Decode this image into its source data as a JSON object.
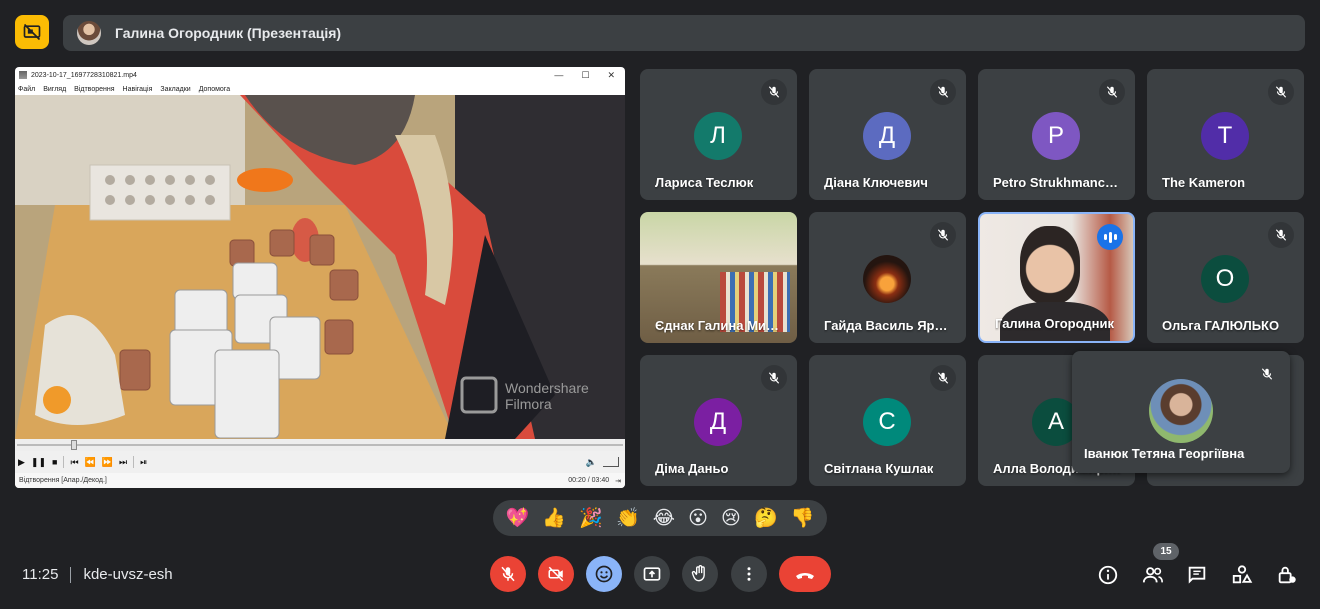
{
  "presenter": {
    "name": "Галина Огородник (Презентація)"
  },
  "shared_window": {
    "title": "2023-10-17_1697728310821.mp4",
    "menu": [
      "Файл",
      "Вигляд",
      "Відтворення",
      "Навігація",
      "Закладки",
      "Допомога"
    ],
    "watermark_line1": "Wondershare",
    "watermark_line2": "Filmora",
    "status": "Відтворення [Апар./Декод.]",
    "time": "00:20 / 03:40"
  },
  "participants": [
    {
      "name": "Лариса Теслюк",
      "initial": "Л",
      "color": "#137a6b"
    },
    {
      "name": "Діана Ключевич",
      "initial": "Д",
      "color": "#5c6bc0"
    },
    {
      "name": "Petro Strukhmanchuk",
      "initial": "P",
      "color": "#7e57c2"
    },
    {
      "name": "The Kameron",
      "initial": "T",
      "color": "#512da8"
    },
    {
      "name": "Єднак Галина Михайлівна",
      "initial": "",
      "color": ""
    },
    {
      "name": "Гайда Василь Ярославович",
      "initial": "",
      "color": ""
    },
    {
      "name": "Галина Огородник",
      "initial": "",
      "color": ""
    },
    {
      "name": "Ольга ГАЛЮЛЬКО",
      "initial": "О",
      "color": "#0b4d3e"
    },
    {
      "name": "Діма Даньо",
      "initial": "Д",
      "color": "#7b1fa2"
    },
    {
      "name": "Світлана Кушлак",
      "initial": "С",
      "color": "#00897b"
    },
    {
      "name": "Алла Володимирівна",
      "initial": "А",
      "color": "#0b4d3e"
    }
  ],
  "floating_participant": {
    "name": "Іванюк Тетяна Георгіївна"
  },
  "reactions": [
    "💖",
    "👍",
    "🎉",
    "👏",
    "😂",
    "😮",
    "😢",
    "🤔",
    "👎"
  ],
  "meeting": {
    "time": "11:25",
    "code": "kde-uvsz-esh"
  },
  "people_count": "15",
  "colors": {
    "background": "#202124",
    "tile": "#3c4043",
    "accent_yellow": "#fbbc04",
    "danger": "#ea4335",
    "active_blue": "#8ab4f8"
  },
  "icons": {
    "present": "present-off-icon",
    "mic": "mic-off-icon",
    "camera": "camera-off-icon",
    "emoji": "emoji-icon",
    "share": "present-screen-icon",
    "hand": "raise-hand-icon",
    "more": "more-vert-icon",
    "leave": "call-end-icon",
    "info": "info-icon",
    "people": "people-icon",
    "chat": "chat-icon",
    "activities": "activities-icon",
    "lock": "host-controls-icon"
  }
}
